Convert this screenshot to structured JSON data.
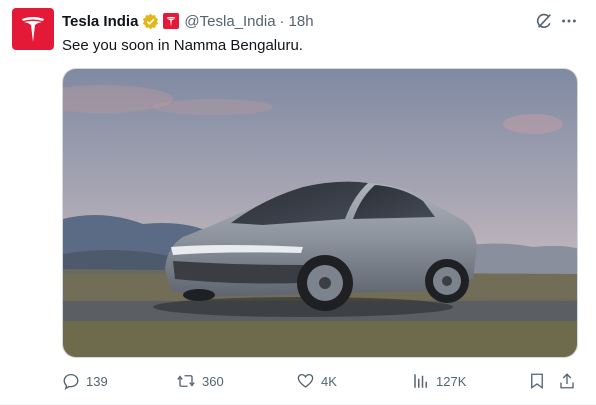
{
  "account": {
    "display_name": "Tesla India",
    "handle": "@Tesla_India",
    "separator": "·",
    "timestamp": "18h",
    "avatar_icon": "tesla-logo-icon",
    "brand_color": "#e31937",
    "verified_color": "#e2b719"
  },
  "tweet": {
    "text": "See you soon in Namma Bengaluru.",
    "media_description_icon": "car-photo"
  },
  "actions": {
    "reply_count": "139",
    "repost_count": "360",
    "like_count": "4K",
    "views_count": "127K"
  },
  "colors": {
    "text_primary": "#0f1419",
    "text_secondary": "#536471",
    "border": "#cfd9de"
  }
}
